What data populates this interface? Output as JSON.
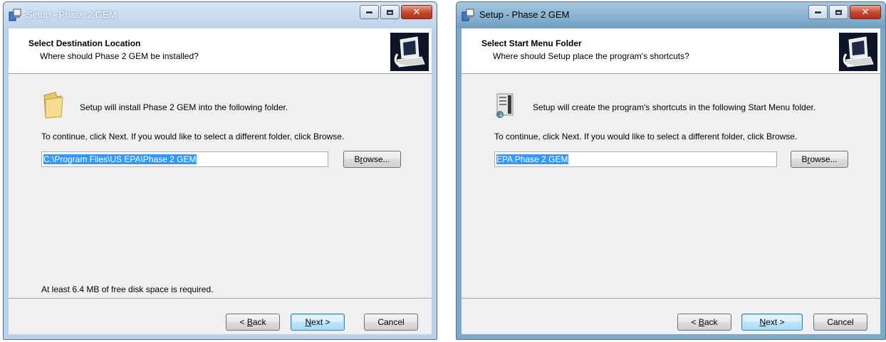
{
  "left": {
    "title": "Setup - Phase 2 GEM",
    "header_title": "Select Destination Location",
    "header_sub": "Where should Phase 2 GEM be installed?",
    "intro": "Setup will install Phase 2 GEM into the following folder.",
    "cont": "To continue, click Next. If you would like to select a different folder, click Browse.",
    "path_value": "C:\\Program Files\\US EPA\\Phase 2 GEM",
    "browse_a": "B",
    "browse_u": "r",
    "browse_b": "owse...",
    "diskspace": "At least 6.4 MB of free disk space is required.",
    "back_a": "< ",
    "back_u": "B",
    "back_b": "ack",
    "next_u": "N",
    "next_b": "ext >",
    "cancel": "Cancel",
    "body_icon": "folder-icon"
  },
  "right": {
    "title": "Setup - Phase 2 GEM",
    "header_title": "Select Start Menu Folder",
    "header_sub": "Where should Setup place the program's shortcuts?",
    "intro": "Setup will create the program's shortcuts in the following Start Menu folder.",
    "cont": "To continue, click Next. If you would like to select a different folder, click Browse.",
    "path_value": "EPA Phase 2 GEM",
    "browse_a": "B",
    "browse_u": "r",
    "browse_b": "owse...",
    "back_a": "< ",
    "back_u": "B",
    "back_b": "ack",
    "next_u": "N",
    "next_b": "ext >",
    "cancel": "Cancel",
    "body_icon": "start-menu-icon"
  }
}
